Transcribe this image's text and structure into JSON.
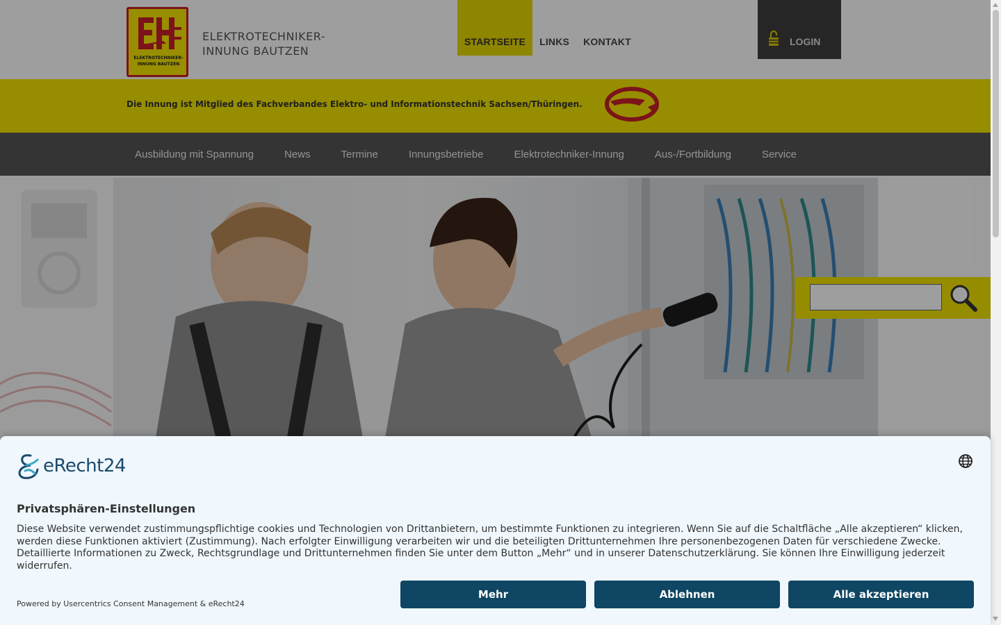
{
  "header": {
    "logo_caption": "ELEKTROTECHNIKER-INNUNG BAUTZEN",
    "org_name_line1": "ELEKTROTECHNIKER-",
    "org_name_line2": "INNUNG BAUTZEN",
    "topnav": [
      {
        "label": "STARTSEITE",
        "active": true
      },
      {
        "label": "LINKS",
        "active": false
      },
      {
        "label": "KONTAKT",
        "active": false
      }
    ],
    "login_label": "LOGIN",
    "login_icon": "lock-icon"
  },
  "band": {
    "text": "Die Innung ist Mitglied des Fachverbandes Elektro- und Informationstechnik Sachsen/Thüringen.",
    "logo_icon": "fachverband-logo"
  },
  "mainnav": {
    "items": [
      {
        "label": "Ausbildung mit Spannung"
      },
      {
        "label": "News"
      },
      {
        "label": "Termine"
      },
      {
        "label": "Innungsbetriebe"
      },
      {
        "label": "Elektrotechniker-Innung"
      },
      {
        "label": "Aus-/Fortbildung"
      },
      {
        "label": "Service"
      }
    ]
  },
  "search": {
    "value": "",
    "placeholder": "",
    "icon": "magnifier-icon"
  },
  "consent": {
    "brand": "eRecht24",
    "title": "Privatsphären-Einstellungen",
    "text": "Diese Website verwendet zustimmungspflichtige cookies und Technologien von Drittanbietern, um bestimmte Funktionen zu integrieren. Wenn Sie auf die Schaltfläche „Alle akzeptieren“ klicken, werden diese Funktionen aktiviert (Zustimmung). Nach erfolgter Einwilligung verarbeiten wir und die beteiligten Drittunternehmen Ihre personenbezogenen Daten für verschiedene Zwecke. Detaillierte Informationen zu Zweck, Rechtsgrundlage und Drittunternehmen finden Sie unter dem Button „Mehr“ und in unserer Datenschutzerklärung. Sie können Ihre Einwilligung jederzeit widerrufen.",
    "powered_by": "Powered by Usercentrics Consent Management & eRecht24",
    "buttons": {
      "more": "Mehr",
      "decline": "Ablehnen",
      "accept": "Alle akzeptieren"
    },
    "language_icon": "globe-icon"
  },
  "colors": {
    "brand_yellow": "#f2e600",
    "nav_dark": "#545454",
    "consent_button": "#0e4663",
    "logo_red": "#c8202a"
  }
}
